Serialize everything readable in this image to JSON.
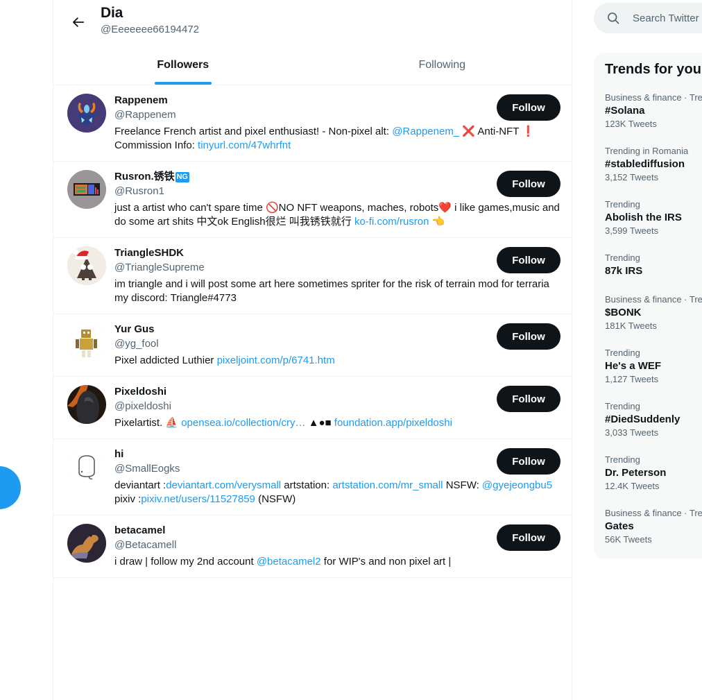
{
  "left_rail": {
    "compose_label": "compose-tweet"
  },
  "header": {
    "back_icon": "arrow-left-icon",
    "title": "Dia",
    "handle": "@Eeeeeee66194472"
  },
  "tabs": [
    {
      "label": "Followers",
      "active": true
    },
    {
      "label": "Following",
      "active": false
    }
  ],
  "follow_label": "Follow",
  "followers": [
    {
      "display_name": "Rappenem",
      "badge": "",
      "handle": "@Rappenem",
      "avatar": "knight-helmet-avatar",
      "bio": [
        {
          "t": "Freelance French artist and pixel enthusiast! - Non-pixel alt: ",
          "link": false
        },
        {
          "t": "@Rappenem_",
          "link": true
        },
        {
          "t": " ",
          "link": false
        },
        {
          "t": "❌",
          "link": false
        },
        {
          "t": " Anti-NFT ",
          "link": false
        },
        {
          "t": "❗",
          "link": false
        },
        {
          "t": " Commission Info: ",
          "link": false
        },
        {
          "t": "tinyurl.com/47whrfnt",
          "link": true
        }
      ]
    },
    {
      "display_name": "Rusron.锈铁",
      "badge": "NG",
      "handle": "@Rusron1",
      "avatar": "pixel-art-screen-avatar",
      "bio": [
        {
          "t": "just a artist who can't spare time ",
          "link": false
        },
        {
          "t": "🚫",
          "link": false
        },
        {
          "t": "NO NFT weapons, maches, robots",
          "link": false
        },
        {
          "t": "❤️",
          "link": false
        },
        {
          "t": " i like games,music and do some art shits 中文ok English很烂 叫我锈铁就行 ",
          "link": false
        },
        {
          "t": "ko-fi.com/rusron",
          "link": true
        },
        {
          "t": " 👈",
          "link": false
        }
      ]
    },
    {
      "display_name": "TriangleSHDK",
      "badge": "",
      "handle": "@TriangleSupreme",
      "avatar": "santa-hat-creature-avatar",
      "bio": [
        {
          "t": "im triangle and i will post some art here sometimes spriter for the risk of terrain mod for terraria my discord: Triangle#4773",
          "link": false
        }
      ]
    },
    {
      "display_name": "Yur Gus",
      "badge": "",
      "handle": "@yg_fool",
      "avatar": "golden-robot-avatar",
      "bio": [
        {
          "t": "Pixel addicted Luthier ",
          "link": false
        },
        {
          "t": "pixeljoint.com/p/6741.htm",
          "link": true
        }
      ]
    },
    {
      "display_name": "Pixeldoshi",
      "badge": "",
      "handle": "@pixeldoshi",
      "avatar": "hooded-figure-avatar",
      "bio": [
        {
          "t": "Pixelartist. ",
          "link": false
        },
        {
          "t": "⛵",
          "link": false
        },
        {
          "t": " ",
          "link": false
        },
        {
          "t": "opensea.io/collection/cry…",
          "link": true
        },
        {
          "t": " ▲●■ ",
          "link": false
        },
        {
          "t": "foundation.app/pixeldoshi",
          "link": true
        }
      ]
    },
    {
      "display_name": "hi",
      "badge": "",
      "handle": "@SmallEogks",
      "avatar": "sketch-blob-avatar",
      "bio": [
        {
          "t": "deviantart :",
          "link": false
        },
        {
          "t": "deviantart.com/verysmall",
          "link": true
        },
        {
          "t": " artstation: ",
          "link": false
        },
        {
          "t": "artstation.com/mr_small",
          "link": true
        },
        {
          "t": " NSFW: ",
          "link": false
        },
        {
          "t": "@gyejeongbu5",
          "link": true
        },
        {
          "t": " pixiv :",
          "link": false
        },
        {
          "t": "pixiv.net/users/11527859",
          "link": true
        },
        {
          "t": " (NSFW)",
          "link": false
        }
      ]
    },
    {
      "display_name": "betacamel",
      "badge": "",
      "handle": "@Betacamell",
      "avatar": "camel-avatar",
      "bio": [
        {
          "t": "i draw | follow my 2nd account ",
          "link": false
        },
        {
          "t": "@betacamel2",
          "link": true
        },
        {
          "t": " for WIP's and non pixel art |",
          "link": false
        }
      ]
    }
  ],
  "sidebar": {
    "search": {
      "placeholder": "Search Twitter",
      "value": "",
      "icon": "search-icon"
    },
    "trends_title": "Trends for you",
    "trends": [
      {
        "context": "Business & finance · Trending",
        "name": "#Solana",
        "count": "123K Tweets"
      },
      {
        "context": "Trending in Romania",
        "name": "#stablediffusion",
        "count": "3,152 Tweets"
      },
      {
        "context": "Trending",
        "name": "Abolish the IRS",
        "count": "3,599 Tweets"
      },
      {
        "context": "Trending",
        "name": "87k IRS",
        "count": ""
      },
      {
        "context": "Business & finance · Trending",
        "name": "$BONK",
        "count": "181K Tweets"
      },
      {
        "context": "Trending",
        "name": "He's a WEF",
        "count": "1,127 Tweets"
      },
      {
        "context": "Trending",
        "name": "#DiedSuddenly",
        "count": "3,033 Tweets"
      },
      {
        "context": "Trending",
        "name": "Dr. Peterson",
        "count": "12.4K Tweets"
      },
      {
        "context": "Business & finance · Trending",
        "name": "Gates",
        "count": "56K Tweets"
      }
    ]
  },
  "colors": {
    "accent": "#1d9bf0",
    "text": "#0f1419",
    "muted": "#536471",
    "border": "#eff3f4",
    "button": "#0f1419",
    "card": "#f7f9f9"
  }
}
